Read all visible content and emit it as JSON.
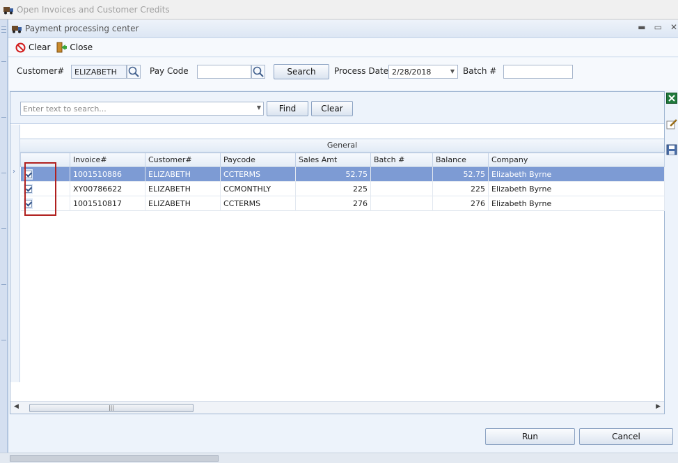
{
  "outer_window": {
    "title": "Open Invoices and Customer Credits"
  },
  "window": {
    "title": "Payment processing center",
    "minimize": "▬",
    "restore": "▭",
    "close": "✕"
  },
  "toolbar": {
    "clear_label": "Clear",
    "close_label": "Close"
  },
  "filters": {
    "customer_label": "Customer#",
    "customer_value": "ELIZABETH",
    "paycode_label": "Pay Code",
    "paycode_value": "",
    "search_button": "Search",
    "process_date_label": "Process Date",
    "process_date_value": "2/28/2018",
    "batch_label": "Batch #",
    "batch_value": ""
  },
  "grid_search": {
    "placeholder": "Enter text to search...",
    "find_button": "Find",
    "clear_button": "Clear"
  },
  "grid": {
    "group_label": "General",
    "columns": [
      "",
      "Invoice#",
      "Customer#",
      "Paycode",
      "Sales Amt",
      "Batch #",
      "Balance",
      "Company"
    ],
    "rows": [
      {
        "checked": true,
        "invoice": "1001510886",
        "customer": "ELIZABETH",
        "paycode": "CCTERMS",
        "sales_amt": "52.75",
        "batch": "",
        "balance": "52.75",
        "company": "Elizabeth Byrne",
        "selected": true
      },
      {
        "checked": true,
        "invoice": "XY00786622",
        "customer": "ELIZABETH",
        "paycode": "CCMONTHLY",
        "sales_amt": "225",
        "batch": "",
        "balance": "225",
        "company": "Elizabeth Byrne",
        "selected": false
      },
      {
        "checked": true,
        "invoice": "1001510817",
        "customer": "ELIZABETH",
        "paycode": "CCTERMS",
        "sales_amt": "276",
        "batch": "",
        "balance": "276",
        "company": "Elizabeth Byrne",
        "selected": false
      }
    ]
  },
  "footer": {
    "run_button": "Run",
    "cancel_button": "Cancel"
  },
  "icons": {
    "clear": "no-entry-icon",
    "close": "exit-door-icon",
    "search": "magnifier-icon",
    "excel": "excel-export-icon",
    "edit": "edit-note-icon",
    "save": "save-disk-icon"
  },
  "colors": {
    "selected_row": "#7d9bd4",
    "highlight_box": "#b0201f"
  }
}
